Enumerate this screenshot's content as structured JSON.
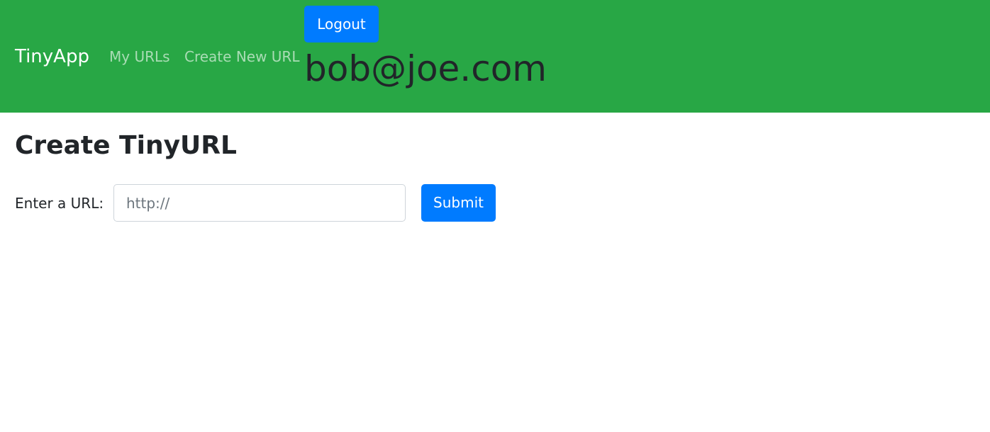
{
  "navbar": {
    "brand": "TinyApp",
    "links": [
      {
        "label": "My URLs"
      },
      {
        "label": "Create New URL"
      }
    ],
    "logout_label": "Logout",
    "user_email": "bob@joe.com",
    "background_color": "#28a745"
  },
  "main": {
    "title": "Create TinyURL",
    "form": {
      "url_label": "Enter a URL:",
      "url_placeholder": "http://",
      "url_value": "",
      "submit_label": "Submit"
    }
  },
  "colors": {
    "primary_button": "#007bff",
    "nav_green": "#28a745"
  }
}
